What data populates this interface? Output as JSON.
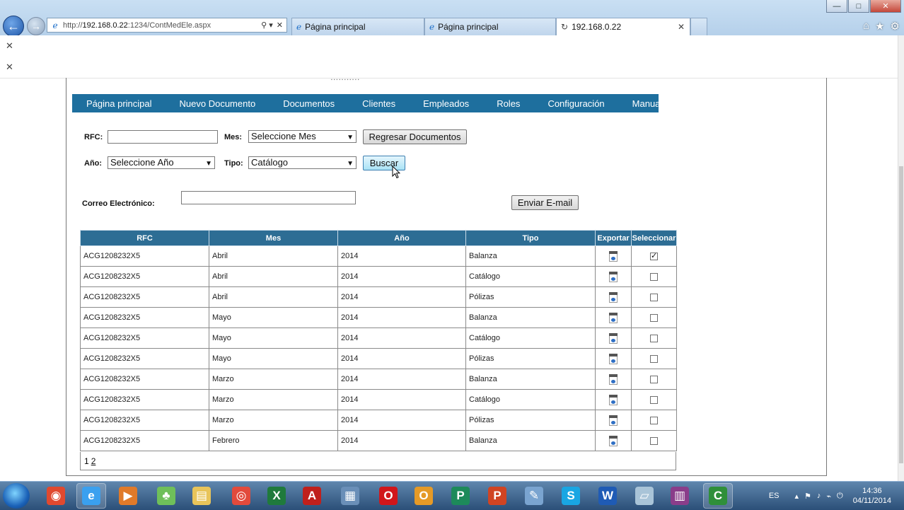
{
  "browser": {
    "address": {
      "prefix": "http://",
      "host": "192.168.0.22",
      "rest": ":1234/ContMedEle.aspx"
    },
    "tabs": [
      {
        "label": "Página principal",
        "active": false
      },
      {
        "label": "Página principal",
        "active": false
      },
      {
        "label": "192.168.0.22",
        "active": true
      }
    ],
    "window_controls": {
      "minimize": "—",
      "maximize": "□",
      "close": "✕"
    },
    "toolbar_icons": [
      "home-icon",
      "favorites-star-icon",
      "gear-icon"
    ]
  },
  "infobars": [
    "✕",
    "✕"
  ],
  "menu": [
    "Página principal",
    "Nuevo Documento",
    "Documentos",
    "Clientes",
    "Empleados",
    "Roles",
    "Configuración",
    "Manual"
  ],
  "filters": {
    "rfc_label": "RFC:",
    "rfc_value": "",
    "mes_label": "Mes:",
    "mes_selected": "Seleccione Mes",
    "regresar_label": "Regresar Documentos",
    "anio_label": "Año:",
    "anio_selected": "Seleccione Año",
    "tipo_label": "Tipo:",
    "tipo_selected": "Catálogo",
    "buscar_label": "Buscar"
  },
  "email": {
    "label": "Correo Electrónico:",
    "value": "",
    "send_label": "Enviar E-mail"
  },
  "table": {
    "headers": [
      "RFC",
      "Mes",
      "Año",
      "Tipo",
      "Exportar",
      "Seleccionar"
    ],
    "rows": [
      {
        "rfc": "ACG1208232X5",
        "mes": "Abril",
        "anio": "2014",
        "tipo": "Balanza",
        "checked": true
      },
      {
        "rfc": "ACG1208232X5",
        "mes": "Abril",
        "anio": "2014",
        "tipo": "Catálogo",
        "checked": false
      },
      {
        "rfc": "ACG1208232X5",
        "mes": "Abril",
        "anio": "2014",
        "tipo": "Pólizas",
        "checked": false
      },
      {
        "rfc": "ACG1208232X5",
        "mes": "Mayo",
        "anio": "2014",
        "tipo": "Balanza",
        "checked": false
      },
      {
        "rfc": "ACG1208232X5",
        "mes": "Mayo",
        "anio": "2014",
        "tipo": "Catálogo",
        "checked": false
      },
      {
        "rfc": "ACG1208232X5",
        "mes": "Mayo",
        "anio": "2014",
        "tipo": "Pólizas",
        "checked": false
      },
      {
        "rfc": "ACG1208232X5",
        "mes": "Marzo",
        "anio": "2014",
        "tipo": "Balanza",
        "checked": false
      },
      {
        "rfc": "ACG1208232X5",
        "mes": "Marzo",
        "anio": "2014",
        "tipo": "Catálogo",
        "checked": false
      },
      {
        "rfc": "ACG1208232X5",
        "mes": "Marzo",
        "anio": "2014",
        "tipo": "Pólizas",
        "checked": false
      },
      {
        "rfc": "ACG1208232X5",
        "mes": "Febrero",
        "anio": "2014",
        "tipo": "Balanza",
        "checked": false
      }
    ],
    "pager": {
      "current": "1",
      "next": "2"
    }
  },
  "taskbar": {
    "apps": [
      {
        "name": "media-player-icon",
        "glyph": "◉",
        "color": "#e0492f"
      },
      {
        "name": "internet-explorer-icon",
        "glyph": "e",
        "color": "#3aa0ef",
        "active": true
      },
      {
        "name": "video-icon",
        "glyph": "▶",
        "color": "#e07a2a"
      },
      {
        "name": "users-icon",
        "glyph": "♣",
        "color": "#6fbf5a"
      },
      {
        "name": "folder-icon",
        "glyph": "▤",
        "color": "#e8c45a"
      },
      {
        "name": "chrome-icon",
        "glyph": "◎",
        "color": "#e24a3c"
      },
      {
        "name": "excel-icon",
        "glyph": "X",
        "color": "#1f7a3c"
      },
      {
        "name": "pdf-icon",
        "glyph": "A",
        "color": "#c0201c"
      },
      {
        "name": "network-icon",
        "glyph": "▦",
        "color": "#6a8fb8"
      },
      {
        "name": "opera-icon",
        "glyph": "O",
        "color": "#d1161b"
      },
      {
        "name": "outlook-icon",
        "glyph": "O",
        "color": "#e59a27"
      },
      {
        "name": "publisher-icon",
        "glyph": "P",
        "color": "#1d8a5a"
      },
      {
        "name": "powerpoint-icon",
        "glyph": "P",
        "color": "#d04423"
      },
      {
        "name": "paint-icon",
        "glyph": "✎",
        "color": "#7aa4d0"
      },
      {
        "name": "skype-icon",
        "glyph": "S",
        "color": "#19a6e3"
      },
      {
        "name": "word-icon",
        "glyph": "W",
        "color": "#1f5bb5"
      },
      {
        "name": "notepad-icon",
        "glyph": "▱",
        "color": "#a9c4d8"
      },
      {
        "name": "winrar-icon",
        "glyph": "▥",
        "color": "#8a3d8a"
      },
      {
        "name": "camtasia-icon",
        "glyph": "C",
        "color": "#2f8f3a",
        "active": true
      }
    ],
    "lang": "ES",
    "time": "14:36",
    "date": "04/11/2014"
  }
}
